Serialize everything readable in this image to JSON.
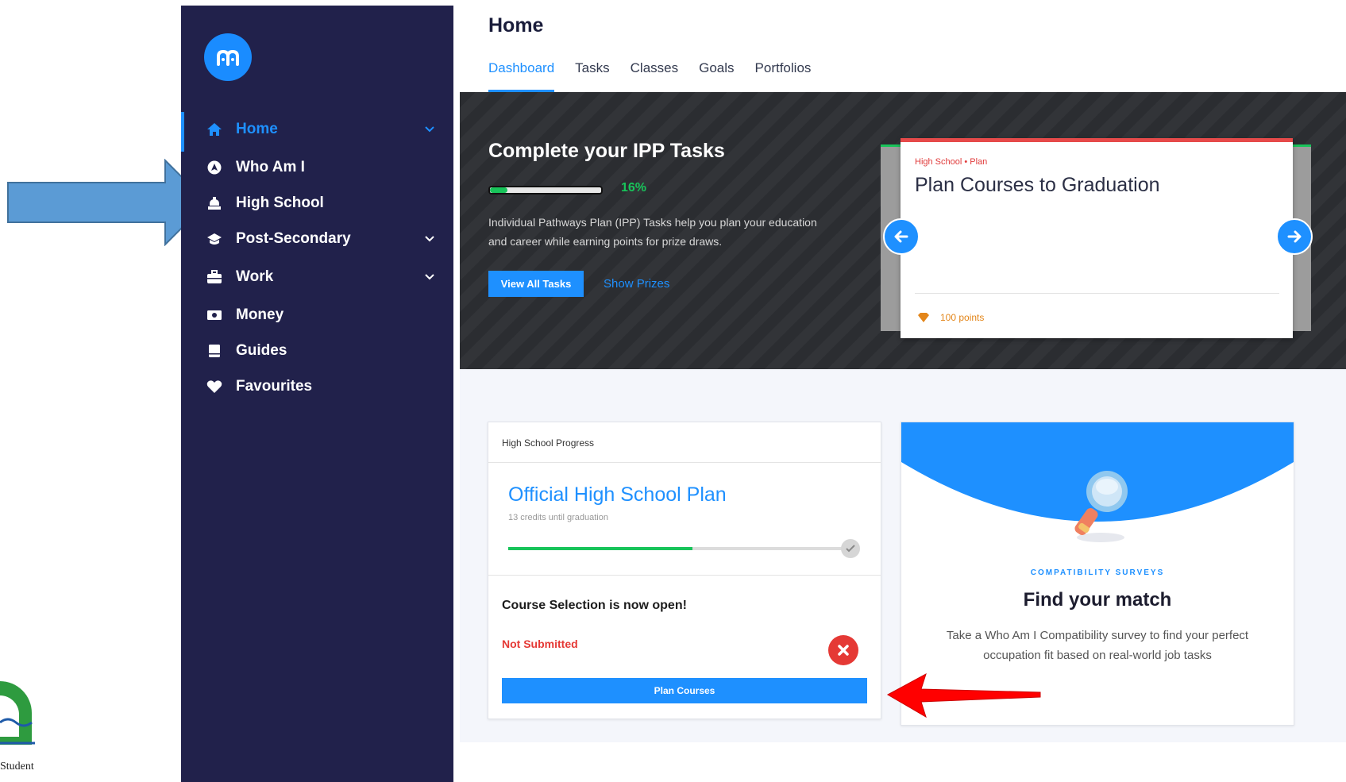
{
  "annotation": {
    "school_caption": "Student"
  },
  "sidebar": {
    "brand_icon": "myblueprint-logo-icon",
    "items": [
      {
        "label": "Home",
        "icon": "home-icon",
        "active": true,
        "expandable": true
      },
      {
        "label": "Who Am I",
        "icon": "compass-icon",
        "active": false,
        "expandable": false
      },
      {
        "label": "High School",
        "icon": "school-bell-icon",
        "active": false,
        "expandable": false
      },
      {
        "label": "Post-Secondary",
        "icon": "graduation-cap-icon",
        "active": false,
        "expandable": true
      },
      {
        "label": "Work",
        "icon": "briefcase-icon",
        "active": false,
        "expandable": true
      },
      {
        "label": "Money",
        "icon": "money-icon",
        "active": false,
        "expandable": false
      },
      {
        "label": "Guides",
        "icon": "book-icon",
        "active": false,
        "expandable": false
      },
      {
        "label": "Favourites",
        "icon": "heart-icon",
        "active": false,
        "expandable": false
      }
    ]
  },
  "header": {
    "title": "Home",
    "tabs": [
      "Dashboard",
      "Tasks",
      "Classes",
      "Goals",
      "Portfolios"
    ],
    "active_tab": "Dashboard"
  },
  "hero": {
    "title": "Complete your IPP Tasks",
    "progress_percent": 16,
    "progress_label": "16%",
    "description": "Individual Pathways Plan (IPP) Tasks help you plan your education and career while earning points for prize draws.",
    "view_button": "View All Tasks",
    "prizes_link": "Show Prizes",
    "task_card": {
      "category": "High School • Plan",
      "title": "Plan Courses to Graduation",
      "points": "100 points"
    }
  },
  "progress_card": {
    "header": "High School Progress",
    "plan_title": "Official High School Plan",
    "credits_text": "13 credits until graduation",
    "progress_fraction": 0.54,
    "course_selection": "Course Selection is now open!",
    "status": "Not Submitted",
    "button": "Plan Courses"
  },
  "match_card": {
    "eyebrow": "COMPATIBILITY SURVEYS",
    "title": "Find your match",
    "description": "Take a Who Am I Compatibility survey to find your perfect occupation fit based on real-world job tasks"
  },
  "colors": {
    "sidebar_bg": "#21214b",
    "accent": "#1e90ff",
    "success": "#18c45a",
    "danger": "#e53935"
  }
}
